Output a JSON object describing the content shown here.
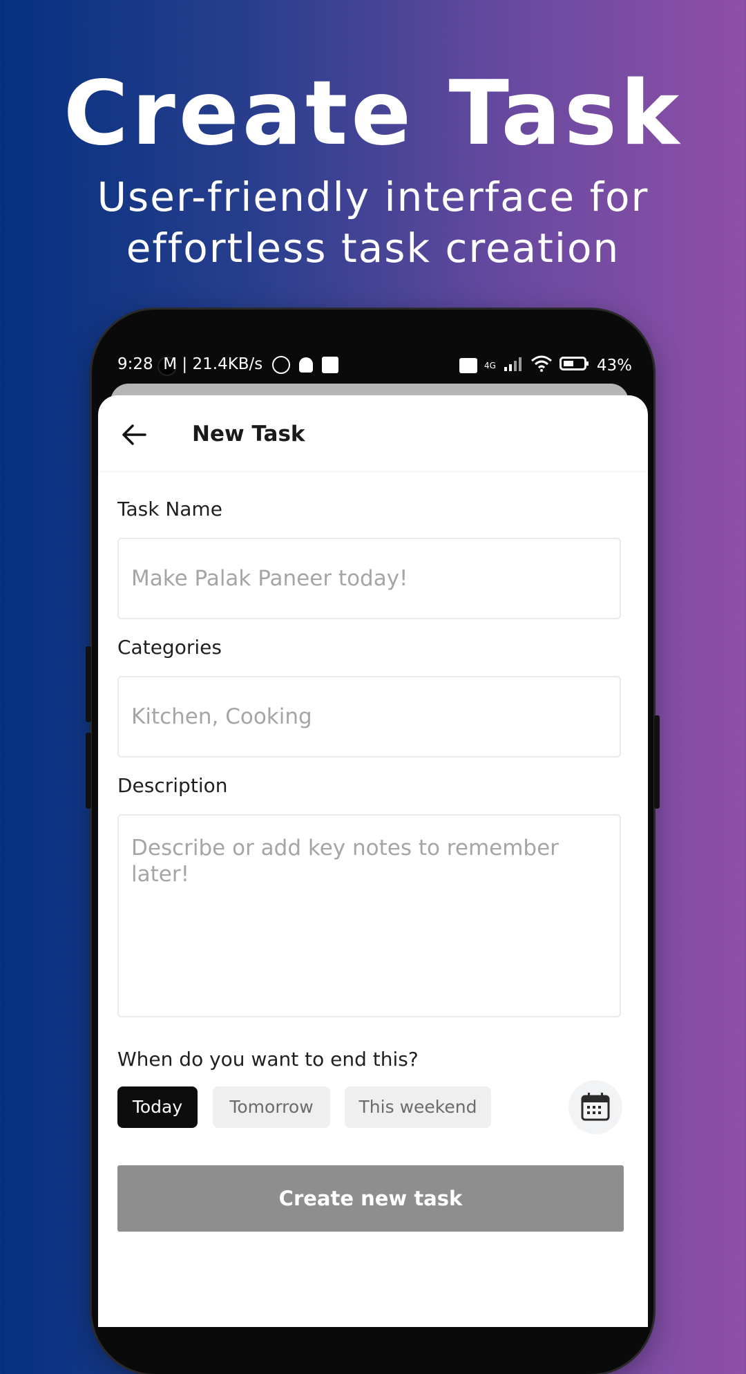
{
  "promo": {
    "headline": "Create Task",
    "subhead_line1": "User-friendly interface for",
    "subhead_line2": "effortless task creation"
  },
  "status_bar": {
    "time_speed": "9:28  M | 21.4KB/s",
    "network": "4G",
    "battery": "43%"
  },
  "app_bar": {
    "title": "New Task",
    "back_icon": "arrow-left-icon"
  },
  "form": {
    "task_name_label": "Task Name",
    "task_name_placeholder": "Make Palak Paneer today!",
    "categories_label": "Categories",
    "categories_placeholder": "Kitchen, Cooking",
    "description_label": "Description",
    "description_placeholder": "Describe or add key notes to remember later!",
    "end_question": "When do you want to end this?",
    "options": [
      {
        "label": "Today",
        "selected": true
      },
      {
        "label": "Tomorrow",
        "selected": false
      },
      {
        "label": "This weekend",
        "selected": false
      }
    ],
    "calendar_icon": "calendar-icon",
    "submit_label": "Create new task"
  },
  "colors": {
    "gradient_start": "#04317f",
    "gradient_end": "#8f4fa7",
    "selected_chip": "#0d0d0d",
    "unselected_chip": "#efefef",
    "submit_button": "#8e8e8e"
  }
}
